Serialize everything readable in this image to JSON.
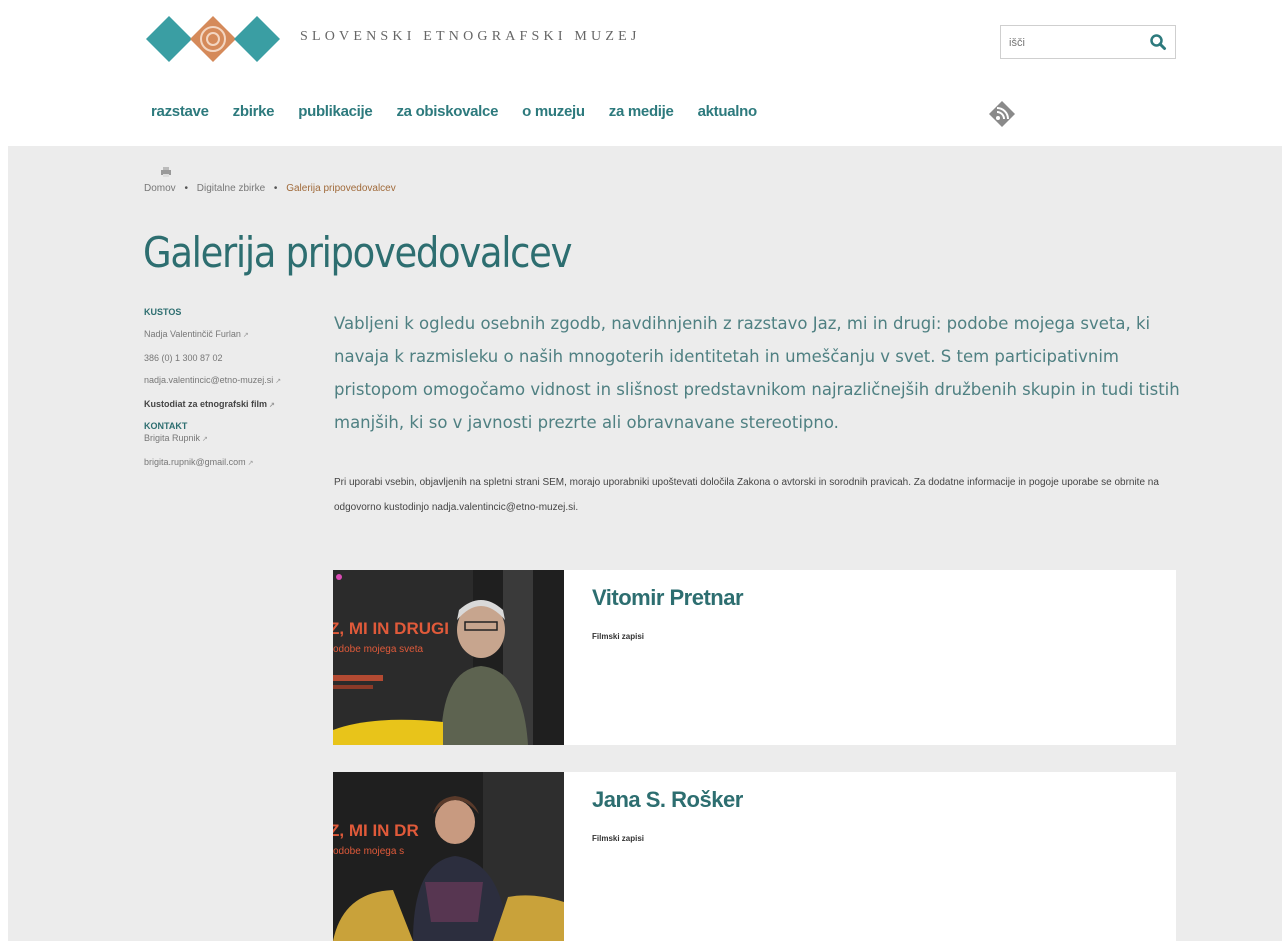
{
  "header": {
    "logo_text": "SLOVENSKI ETNOGRAFSKI MUZEJ",
    "search": {
      "placeholder": "išči",
      "value": ""
    },
    "nav": [
      "razstave",
      "zbirke",
      "publikacije",
      "za obiskovalce",
      "o muzeju",
      "za medije",
      "aktualno"
    ],
    "colors": {
      "accent": "#2d7a7d",
      "logo_teal": "#3a9ea3",
      "logo_orange": "#d58a5a"
    }
  },
  "breadcrumb": [
    "Domov",
    "Digitalne zbirke",
    "Galerija pripovedovalcev"
  ],
  "page_title": "Galerija pripovedovalcev",
  "sidebar": {
    "kustos_heading": "KUSTOS",
    "kustos_name": "Nadja Valentinčič Furlan",
    "phone": "386 (0) 1 300 87 02",
    "email": "nadja.valentincic@etno-muzej.si",
    "kustodiat": "Kustodiat za etnografski film",
    "kontakt_heading": "KONTAKT",
    "kontakt_name": "Brigita Rupnik",
    "kontakt_email": "brigita.rupnik@gmail.com"
  },
  "intro": "Vabljeni k ogledu osebnih zgodb, navdihnjenih z razstavo Jaz, mi in drugi: podobe mojega sveta, ki navaja k razmisleku o naših mnogoterih identitetah in umeščanju v svet. S tem participativnim pristopom omogočamo vidnost in slišnost predstavnikom najrazličnejših družbenih skupin in tudi tistih manjših, ki so v javnosti prezrte ali obravnavane stereotipno.",
  "notice": "Pri uporabi vsebin, objavljenih na spletni strani SEM, morajo uporabniki upoštevati določila Zakona o avtorski in sorodnih pravicah. Za dodatne informacije in pogoje uporabe se obrnite na odgovorno kustodinjo nadja.valentincic@etno-muzej.si.",
  "cards": [
    {
      "name": "Vitomir Pretnar",
      "subtitle": "Filmski zapisi",
      "thumb_text": [
        "Z, MI IN DRUGI",
        "odobe mojega sveta"
      ]
    },
    {
      "name": "Jana S. Rošker",
      "subtitle": "Filmski zapisi",
      "thumb_text": [
        "Z, MI IN DR",
        "odobe mojega s"
      ]
    }
  ]
}
